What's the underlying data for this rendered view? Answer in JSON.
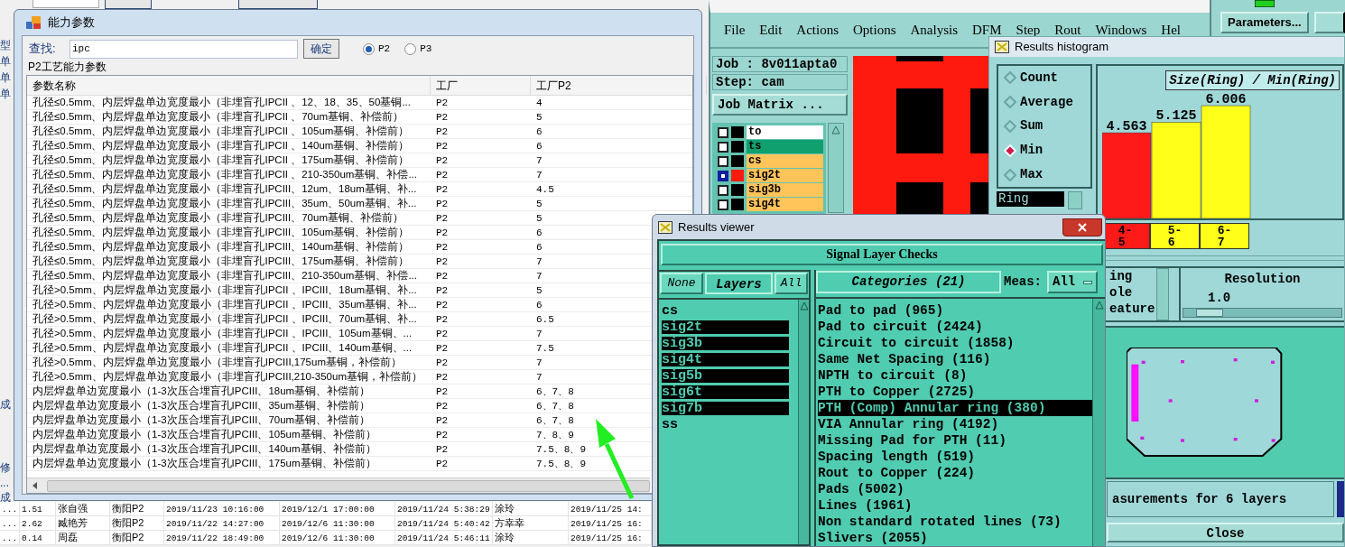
{
  "background": {
    "side_labels": [
      "型",
      "单",
      "单",
      "单",
      "成",
      "修",
      "...",
      "成"
    ],
    "rows": [
      {
        "cells": [
          "...",
          "1.51",
          "张自强",
          "衡阳P2",
          "2019/11/23 10:16:00",
          "2019/12/1 17:00:00",
          "2019/11/24 5:38:29",
          "涂玲",
          "2019/11/25 14:"
        ]
      },
      {
        "cells": [
          "...",
          "2.62",
          "臧艳芳",
          "衡阳P2",
          "2019/11/22 14:27:00",
          "2019/12/6 11:30:00",
          "2019/11/24 5:40:42",
          "方幸幸",
          "2019/11/25 16:"
        ]
      },
      {
        "cells": [
          "...",
          "0.14",
          "周磊",
          "衡阳P2",
          "2019/11/22 18:49:00",
          "2019/12/6 11:30:00",
          "2019/11/24 5:46:11",
          "涂玲",
          "2019/11/25 16:"
        ]
      }
    ]
  },
  "dialog": {
    "title": "能力参数",
    "search_label": "查找:",
    "search_value": "ipc",
    "confirm_button": "确定",
    "options": [
      {
        "label": "P2",
        "selected": true
      },
      {
        "label": "P3",
        "selected": false
      }
    ],
    "group_title": "P2工艺能力参数",
    "columns": [
      "参数名称",
      "工厂",
      "工厂P2"
    ],
    "rows": [
      {
        "name": "孔径≤0.5mm、内层焊盘单边宽度最小（非埋盲孔IPCII 、12、18、35、50基铜...",
        "factory": "P2",
        "value": "4"
      },
      {
        "name": "孔径≤0.5mm、内层焊盘单边宽度最小（非埋盲孔IPCII 、70um基铜、补偿前）",
        "factory": "P2",
        "value": "5"
      },
      {
        "name": "孔径≤0.5mm、内层焊盘单边宽度最小（非埋盲孔IPCII 、105um基铜、补偿前）",
        "factory": "P2",
        "value": "6"
      },
      {
        "name": "孔径≤0.5mm、内层焊盘单边宽度最小（非埋盲孔IPCII 、140um基铜、补偿前）",
        "factory": "P2",
        "value": "6"
      },
      {
        "name": "孔径≤0.5mm、内层焊盘单边宽度最小（非埋盲孔IPCII 、175um基铜、补偿前）",
        "factory": "P2",
        "value": "7"
      },
      {
        "name": "孔径≤0.5mm、内层焊盘单边宽度最小（非埋盲孔IPCII 、210-350um基铜、补偿...",
        "factory": "P2",
        "value": "7"
      },
      {
        "name": "孔径≤0.5mm、内层焊盘单边宽度最小（非埋盲孔IPCIII、12um、18um基铜、补...",
        "factory": "P2",
        "value": "4.5"
      },
      {
        "name": "孔径≤0.5mm、内层焊盘单边宽度最小（非埋盲孔IPCIII、35um、50um基铜、补...",
        "factory": "P2",
        "value": "5"
      },
      {
        "name": "孔径≤0.5mm、内层焊盘单边宽度最小（非埋盲孔IPCIII、70um基铜、补偿前）",
        "factory": "P2",
        "value": "5"
      },
      {
        "name": "孔径≤0.5mm、内层焊盘单边宽度最小（非埋盲孔IPCIII、105um基铜、补偿前）",
        "factory": "P2",
        "value": "6"
      },
      {
        "name": "孔径≤0.5mm、内层焊盘单边宽度最小（非埋盲孔IPCIII、140um基铜、补偿前）",
        "factory": "P2",
        "value": "6"
      },
      {
        "name": "孔径≤0.5mm、内层焊盘单边宽度最小（非埋盲孔IPCIII、175um基铜、补偿前）",
        "factory": "P2",
        "value": "7"
      },
      {
        "name": "孔径≤0.5mm、内层焊盘单边宽度最小（非埋盲孔IPCIII、210-350um基铜、补偿...",
        "factory": "P2",
        "value": "7"
      },
      {
        "name": "孔径>0.5mm、内层焊盘单边宽度最小（非埋盲孔IPCII 、IPCIII、18um基铜、补...",
        "factory": "P2",
        "value": "5"
      },
      {
        "name": "孔径>0.5mm、内层焊盘单边宽度最小（非埋盲孔IPCII 、IPCIII、35um基铜、补...",
        "factory": "P2",
        "value": "6"
      },
      {
        "name": "孔径>0.5mm、内层焊盘单边宽度最小（非埋盲孔IPCII 、IPCIII、70um基铜、补...",
        "factory": "P2",
        "value": "6.5"
      },
      {
        "name": "孔径>0.5mm、内层焊盘单边宽度最小（非埋盲孔IPCII 、IPCIII、105um基铜、...",
        "factory": "P2",
        "value": "7"
      },
      {
        "name": "孔径>0.5mm、内层焊盘单边宽度最小（非埋盲孔IPCII 、IPCIII、140um基铜、...",
        "factory": "P2",
        "value": "7.5"
      },
      {
        "name": "孔径>0.5mm、内层焊盘单边宽度最小（非埋盲孔IPCIII,175um基铜，补偿前）",
        "factory": "P2",
        "value": "7"
      },
      {
        "name": "孔径>0.5mm、内层焊盘单边宽度最小（非埋盲孔IPCIII,210-350um基铜，补偿前）",
        "factory": "P2",
        "value": "7"
      },
      {
        "name": "内层焊盘单边宽度最小（1-3次压合埋盲孔IPCIII、18um基铜、补偿前）",
        "factory": "P2",
        "value": "6、7、8"
      },
      {
        "name": "内层焊盘单边宽度最小（1-3次压合埋盲孔IPCIII、35um基铜、补偿前）",
        "factory": "P2",
        "value": "6、7、8"
      },
      {
        "name": "内层焊盘单边宽度最小（1-3次压合埋盲孔IPCIII、70um基铜、补偿前）",
        "factory": "P2",
        "value": "6、7、8"
      },
      {
        "name": "内层焊盘单边宽度最小（1-3次压合埋盲孔IPCIII、105um基铜、补偿前）",
        "factory": "P2",
        "value": "7、8、9"
      },
      {
        "name": "内层焊盘单边宽度最小（1-3次压合埋盲孔IPCIII、140um基铜、补偿前）",
        "factory": "P2",
        "value": "7.5、8、9"
      },
      {
        "name": "内层焊盘单边宽度最小（1-3次压合埋盲孔IPCIII、175um基铜、补偿前）",
        "factory": "P2",
        "value": "7.5、8、9"
      }
    ]
  },
  "cam": {
    "menu": [
      "File",
      "Edit",
      "Actions",
      "Options",
      "Analysis",
      "DFM",
      "Step",
      "Rout",
      "Windows",
      "Hel"
    ],
    "job": "Job : 8v011apta0",
    "step": "Step: cam",
    "matrix_button": "Job Matrix ...",
    "layers": [
      {
        "name": "to",
        "color": "#ffffff",
        "active": false
      },
      {
        "name": "ts",
        "color": "#10a070",
        "active": false
      },
      {
        "name": "cs",
        "color": "#ffc45a",
        "active": false
      },
      {
        "name": "sig2t",
        "color": "#ffc45a",
        "active": true
      },
      {
        "name": "sig3b",
        "color": "#ffc45a",
        "active": false
      },
      {
        "name": "sig4t",
        "color": "#ffc45a",
        "active": false
      }
    ],
    "parameters_button": "Parameters..."
  },
  "histogram": {
    "title": "Results histogram",
    "modes": [
      {
        "label": "Count",
        "selected": false
      },
      {
        "label": "Average",
        "selected": false
      },
      {
        "label": "Sum",
        "selected": false
      },
      {
        "label": "Min",
        "selected": true
      },
      {
        "label": "Max",
        "selected": false
      }
    ],
    "attribute": "Ring",
    "chart_data": {
      "type": "bar",
      "title": "Size(Ring) / Min(Ring)",
      "categories": [
        "4-5",
        "5-6",
        "6-7"
      ],
      "values": [
        4.563,
        5.125,
        6.006
      ],
      "data_labels": true
    },
    "bins": [
      {
        "color": "#ff1a1a"
      },
      {
        "color": "#ffff1a"
      },
      {
        "color": "#ffff1a"
      }
    ],
    "attribute_list": [
      "ing",
      "ole",
      "eature"
    ],
    "resolution_label": "Resolution",
    "resolution_value": "1.0",
    "resolution": {
      "level": 0.08
    },
    "summary": "asurements for 6 layers",
    "close_button": "Close"
  },
  "viewer": {
    "title": "Results viewer",
    "header": "Signal Layer Checks",
    "none_button": "None",
    "layers_label": "Layers",
    "all_button": "All",
    "layers": [
      {
        "name": "cs",
        "selected": false
      },
      {
        "name": "sig2t",
        "selected": true
      },
      {
        "name": "sig3b",
        "selected": true
      },
      {
        "name": "sig4t",
        "selected": true
      },
      {
        "name": "sig5b",
        "selected": true
      },
      {
        "name": "sig6t",
        "selected": true
      },
      {
        "name": "sig7b",
        "selected": true
      },
      {
        "name": "ss",
        "selected": false
      }
    ],
    "categories_label": "Categories (21)",
    "meas_label": "Meas:",
    "meas_value": "All",
    "categories": [
      {
        "label": "Pad to pad (965)",
        "selected": false
      },
      {
        "label": "Pad to circuit (2424)",
        "selected": false
      },
      {
        "label": "Circuit to circuit (1858)",
        "selected": false
      },
      {
        "label": "Same Net Spacing (116)",
        "selected": false
      },
      {
        "label": "NPTH to circuit (8)",
        "selected": false
      },
      {
        "label": "PTH to Copper (2725)",
        "selected": false
      },
      {
        "label": "PTH (Comp) Annular ring (380)",
        "selected": true
      },
      {
        "label": "VIA Annular ring (4192)",
        "selected": false
      },
      {
        "label": "Missing Pad for PTH (11)",
        "selected": false
      },
      {
        "label": "Spacing length (519)",
        "selected": false
      },
      {
        "label": "Rout to Copper (224)",
        "selected": false
      },
      {
        "label": "Pads (5002)",
        "selected": false
      },
      {
        "label": "Lines (1961)",
        "selected": false
      },
      {
        "label": "Non standard rotated lines (73)",
        "selected": false
      },
      {
        "label": "Slivers (2055)",
        "selected": false
      }
    ]
  }
}
